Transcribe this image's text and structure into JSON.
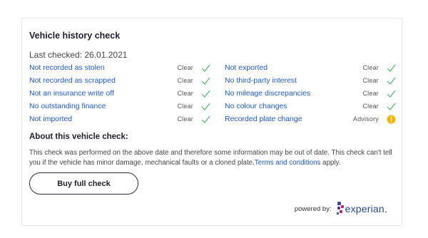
{
  "card": {
    "title": "Vehicle history check",
    "last_checked": "Last checked: 26.01.2021"
  },
  "checks": {
    "left": [
      {
        "label": "Not recorded as stolen",
        "status": "Clear",
        "icon": "check-icon"
      },
      {
        "label": "Not recorded as scrapped",
        "status": "Clear",
        "icon": "check-icon"
      },
      {
        "label": "Not an insurance write off",
        "status": "Clear",
        "icon": "check-icon"
      },
      {
        "label": "No outstanding finance",
        "status": "Clear",
        "icon": "check-icon"
      },
      {
        "label": "Not imported",
        "status": "Clear",
        "icon": "check-icon"
      }
    ],
    "right": [
      {
        "label": "Not exported",
        "status": "Clear",
        "icon": "check-icon"
      },
      {
        "label": "No third-party interest",
        "status": "Clear",
        "icon": "check-icon"
      },
      {
        "label": "No mileage discrepancies",
        "status": "Clear",
        "icon": "check-icon"
      },
      {
        "label": "No colour changes",
        "status": "Clear",
        "icon": "check-icon"
      },
      {
        "label": "Recorded plate change",
        "status": "Advisory",
        "icon": "warning-icon"
      }
    ]
  },
  "about": {
    "title": "About this vehicle check:",
    "text": "This check was performed on the above date and therefore some information may be out of date. This check can't tell you if the vehicle has minor damage, mechanical faults or a cloned plate.",
    "link": "Terms and conditions",
    "after_link": " apply."
  },
  "buy_button": "Buy full check",
  "powered_by": {
    "label": "powered by:",
    "brand": "experian."
  },
  "colors": {
    "link": "#1d57c8",
    "check": "#4bb36a",
    "warning": "#f4b400",
    "brand": "#26478d"
  }
}
